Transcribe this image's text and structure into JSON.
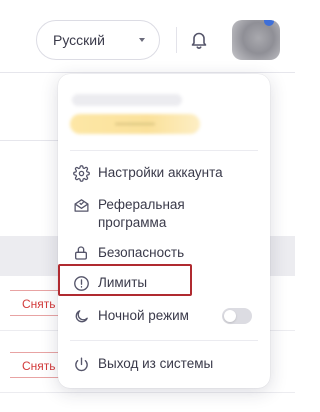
{
  "header": {
    "language_selected": "Русский",
    "language_icon": "chevron-down-icon",
    "notifications_icon": "bell-icon"
  },
  "background": {
    "row_buttons": [
      "Снять",
      "Снять"
    ]
  },
  "menu": {
    "items": [
      {
        "label": "Настройки аккаунта",
        "icon": "gear-icon"
      },
      {
        "label": "Реферальная\nпрограмма",
        "icon": "envelope-icon"
      },
      {
        "label": "Безопасность",
        "icon": "lock-icon"
      },
      {
        "label": "Лимиты",
        "icon": "alert-circle-icon"
      },
      {
        "label": "Ночной режим",
        "icon": "moon-icon",
        "toggle": false
      },
      {
        "label": "Выход из системы",
        "icon": "power-icon"
      }
    ],
    "highlighted_item": "Лимиты",
    "colors": {
      "highlight_border": "#b02a30",
      "danger_text": "#d23b3b"
    }
  }
}
